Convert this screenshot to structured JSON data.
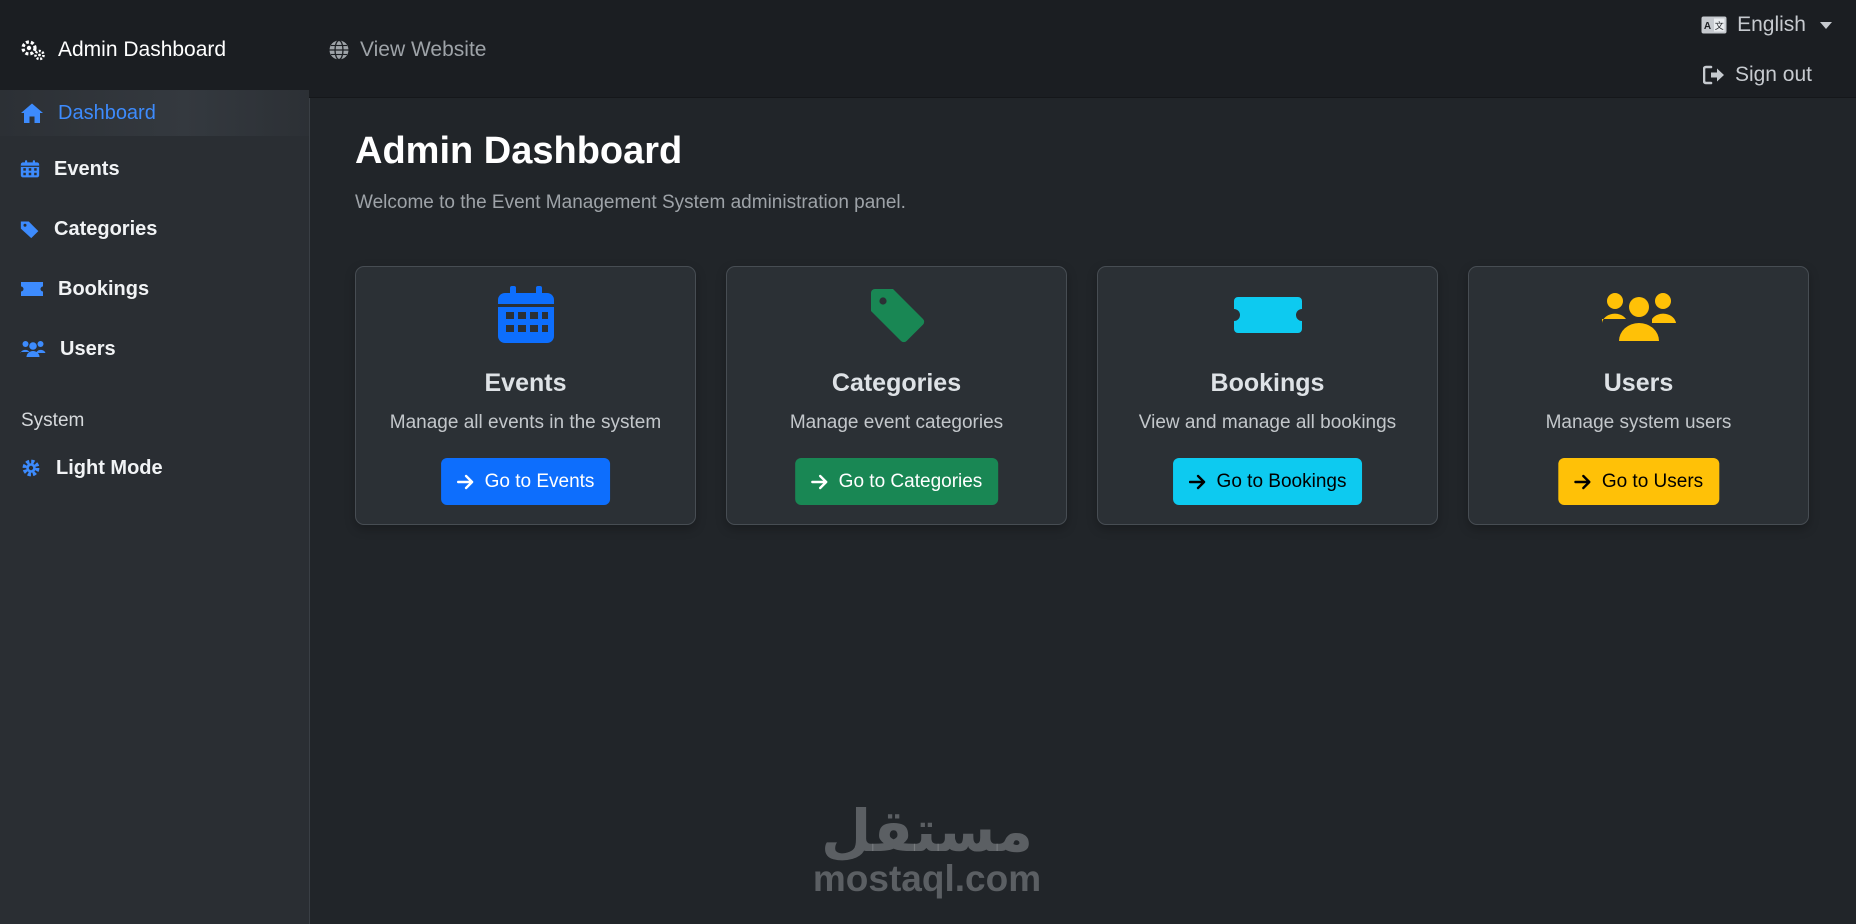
{
  "header": {
    "brand": "Admin Dashboard",
    "brand_icon": "gears-icon",
    "view_website": "View Website",
    "language": "English",
    "sign_out": "Sign out"
  },
  "sidebar": {
    "items": [
      {
        "label": "Dashboard",
        "icon": "home-icon",
        "active": true
      },
      {
        "label": "Events",
        "icon": "calendar-icon"
      },
      {
        "label": "Categories",
        "icon": "tag-icon"
      },
      {
        "label": "Bookings",
        "icon": "ticket-icon"
      },
      {
        "label": "Users",
        "icon": "users-icon"
      }
    ],
    "section_label": "System",
    "mode_toggle": "Light Mode"
  },
  "main": {
    "title": "Admin Dashboard",
    "subtitle": "Welcome to the Event Management System administration panel.",
    "cards": [
      {
        "title": "Events",
        "description": "Manage all events in the system",
        "button": "Go to Events",
        "icon": "calendar-icon",
        "color": "#0d6efd",
        "button_text_color": "#ffffff"
      },
      {
        "title": "Categories",
        "description": "Manage event categories",
        "button": "Go to Categories",
        "icon": "tag-icon",
        "color": "#198754",
        "button_text_color": "#ffffff"
      },
      {
        "title": "Bookings",
        "description": "View and manage all bookings",
        "button": "Go to Bookings",
        "icon": "ticket-icon",
        "color": "#0dcaf0",
        "button_text_color": "#000000"
      },
      {
        "title": "Users",
        "description": "Manage system users",
        "button": "Go to Users",
        "icon": "users-icon",
        "color": "#ffc107",
        "button_text_color": "#000000"
      }
    ]
  },
  "watermark": {
    "arabic": "مستقل",
    "latin": "mostaql.com"
  }
}
